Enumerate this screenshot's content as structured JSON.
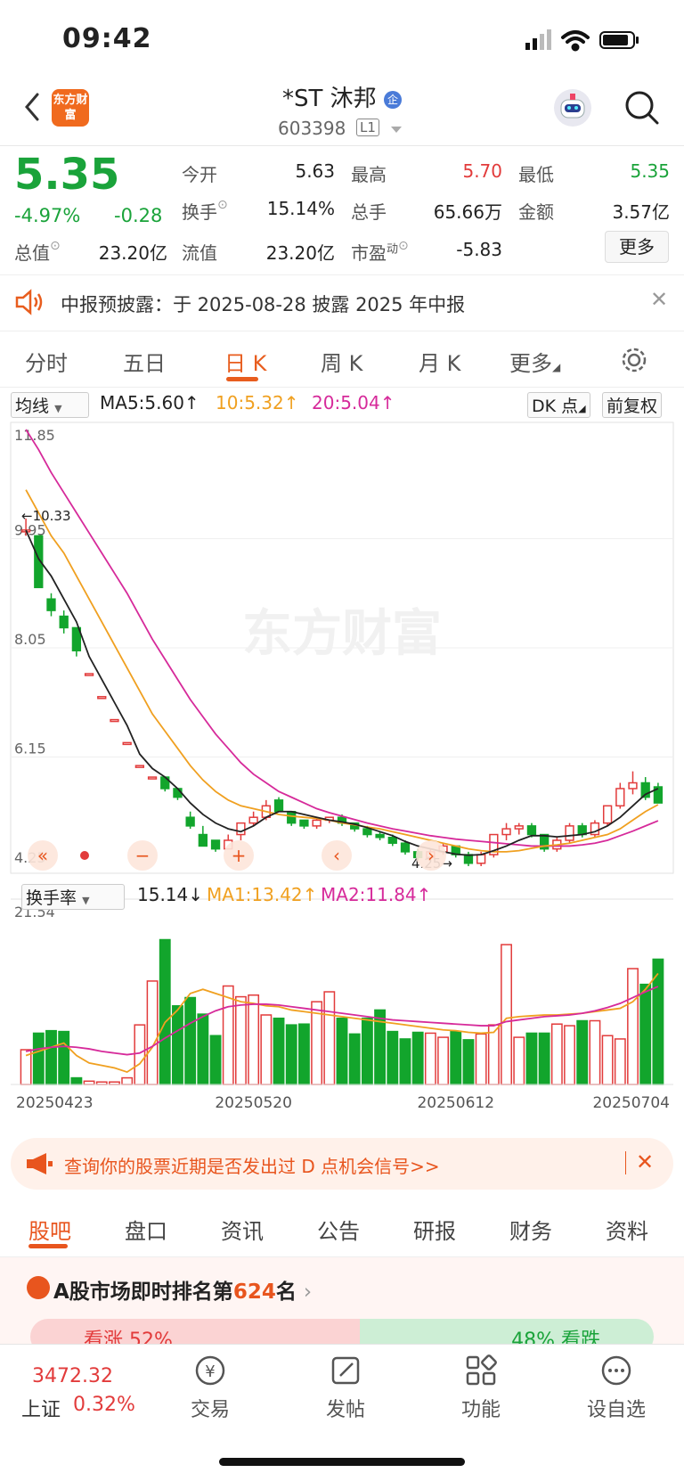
{
  "status": {
    "time": "09:42"
  },
  "header": {
    "logo_text": "东方财富",
    "stock_name": "*ST 沐邦",
    "code": "603398",
    "level_badge": "L1"
  },
  "quote": {
    "price": "5.35",
    "pct_change": "-4.97%",
    "change": "-0.28",
    "open_label": "今开",
    "open_val": "5.63",
    "high_label": "最高",
    "high_val": "5.70",
    "low_label": "最低",
    "low_val": "5.35",
    "turnover_label": "换手",
    "turnover_val": "15.14%",
    "vol_label": "总手",
    "vol_val": "65.66万",
    "amount_label": "金额",
    "amount_val": "3.57亿",
    "mktcap_label": "总值",
    "mktcap_val": "23.20亿",
    "float_label": "流值",
    "float_val": "23.20亿",
    "pe_label": "市盈",
    "pe_sup": "动",
    "pe_val": "-5.83",
    "more_label": "更多"
  },
  "notice": {
    "text": "中报预披露：于 2025-08-28 披露 2025 年中报"
  },
  "tabs": [
    "分时",
    "五日",
    "日 K",
    "周 K",
    "月 K",
    "更多"
  ],
  "chart_toolbar": {
    "ma_select": "均线",
    "ma5": "MA5:5.60↑",
    "ma10": "10:5.32↑",
    "ma20": "20:5.04↑",
    "dk_btn": "DK 点",
    "adjust_btn": "前复权",
    "vol_select": "换手率",
    "vol_val": "15.14↓",
    "vol_ma1": "MA1:13.42↑",
    "vol_ma2": "MA2:11.84↑"
  },
  "colors": {
    "up": "#e23b3b",
    "down": "#12a52c",
    "ma5": "#222222",
    "ma10": "#f0a020",
    "ma20": "#d62a9a",
    "accent": "#e8551e"
  },
  "chart_data": {
    "type": "candlestick",
    "price_axis": {
      "ticks": [
        "11.85",
        "9.95",
        "8.05",
        "6.15",
        "4.25"
      ],
      "ylim": [
        4.25,
        11.85
      ]
    },
    "annotations": {
      "high_label": "10.33",
      "low_label": "4.25"
    },
    "watermark": "东方财富",
    "dates": [
      "20250423",
      "20250520",
      "20250612",
      "20250704"
    ],
    "candles": [
      [
        10.1,
        10.1,
        10.3,
        10.0
      ],
      [
        10.0,
        9.1,
        10.0,
        9.1
      ],
      [
        8.9,
        8.7,
        9.0,
        8.6
      ],
      [
        8.6,
        8.4,
        8.7,
        8.3
      ],
      [
        8.4,
        8.0,
        8.4,
        7.9
      ],
      [
        7.6,
        7.6,
        7.6,
        7.6
      ],
      [
        7.2,
        7.2,
        7.2,
        7.2
      ],
      [
        6.8,
        6.8,
        6.8,
        6.8
      ],
      [
        6.4,
        6.4,
        6.4,
        6.4
      ],
      [
        6.0,
        6.0,
        6.0,
        6.0
      ],
      [
        5.8,
        5.8,
        5.8,
        5.8
      ],
      [
        5.8,
        5.6,
        5.8,
        5.55
      ],
      [
        5.6,
        5.45,
        5.6,
        5.4
      ],
      [
        5.1,
        4.95,
        5.2,
        4.9
      ],
      [
        4.8,
        4.6,
        4.95,
        4.6
      ],
      [
        4.7,
        4.55,
        4.7,
        4.5
      ],
      [
        4.55,
        4.7,
        4.8,
        4.55
      ],
      [
        4.8,
        5.0,
        5.0,
        4.7
      ],
      [
        5.0,
        5.1,
        5.2,
        4.95
      ],
      [
        5.1,
        5.3,
        5.4,
        5.05
      ],
      [
        5.4,
        5.2,
        5.45,
        5.2
      ],
      [
        5.2,
        5.0,
        5.2,
        4.95
      ],
      [
        5.05,
        4.95,
        5.05,
        4.9
      ],
      [
        4.95,
        5.05,
        5.1,
        4.9
      ],
      [
        5.05,
        5.1,
        5.1,
        5.0
      ],
      [
        5.1,
        5.0,
        5.15,
        4.95
      ],
      [
        5.0,
        4.9,
        5.0,
        4.85
      ],
      [
        4.9,
        4.8,
        4.95,
        4.75
      ],
      [
        4.8,
        4.75,
        4.85,
        4.7
      ],
      [
        4.75,
        4.65,
        4.8,
        4.6
      ],
      [
        4.65,
        4.5,
        4.7,
        4.45
      ],
      [
        4.5,
        4.4,
        4.55,
        4.35
      ],
      [
        4.4,
        4.5,
        4.55,
        4.35
      ],
      [
        4.5,
        4.6,
        4.65,
        4.45
      ],
      [
        4.6,
        4.45,
        4.6,
        4.4
      ],
      [
        4.45,
        4.3,
        4.5,
        4.25
      ],
      [
        4.3,
        4.45,
        4.5,
        4.25
      ],
      [
        4.45,
        4.8,
        4.8,
        4.4
      ],
      [
        4.8,
        4.9,
        5.0,
        4.7
      ],
      [
        4.9,
        4.95,
        5.0,
        4.8
      ],
      [
        4.95,
        4.8,
        5.0,
        4.75
      ],
      [
        4.8,
        4.55,
        4.8,
        4.5
      ],
      [
        4.55,
        4.7,
        4.75,
        4.5
      ],
      [
        4.7,
        4.95,
        5.0,
        4.65
      ],
      [
        4.95,
        4.8,
        5.0,
        4.75
      ],
      [
        4.8,
        5.0,
        5.05,
        4.75
      ],
      [
        5.0,
        5.3,
        5.3,
        4.95
      ],
      [
        5.3,
        5.6,
        5.7,
        5.25
      ],
      [
        5.6,
        5.7,
        5.9,
        5.5
      ],
      [
        5.7,
        5.45,
        5.8,
        5.4
      ],
      [
        5.63,
        5.35,
        5.7,
        5.35
      ]
    ],
    "ma5": [
      10.1,
      9.6,
      9.3,
      8.9,
      8.5,
      7.9,
      7.5,
      7.1,
      6.7,
      6.2,
      5.95,
      5.8,
      5.6,
      5.35,
      5.15,
      5.0,
      4.9,
      4.85,
      4.95,
      5.1,
      5.2,
      5.2,
      5.15,
      5.1,
      5.05,
      5.02,
      4.98,
      4.92,
      4.85,
      4.78,
      4.68,
      4.6,
      4.55,
      4.5,
      4.46,
      4.44,
      4.45,
      4.52,
      4.6,
      4.7,
      4.78,
      4.78,
      4.76,
      4.78,
      4.8,
      4.85,
      4.95,
      5.1,
      5.3,
      5.5,
      5.6
    ],
    "ma10": [
      10.8,
      10.4,
      10.0,
      9.7,
      9.3,
      8.9,
      8.5,
      8.1,
      7.7,
      7.3,
      6.9,
      6.6,
      6.3,
      6.0,
      5.75,
      5.55,
      5.4,
      5.3,
      5.25,
      5.2,
      5.15,
      5.12,
      5.1,
      5.08,
      5.05,
      5.0,
      4.97,
      4.93,
      4.9,
      4.85,
      4.8,
      4.75,
      4.7,
      4.65,
      4.6,
      4.55,
      4.52,
      4.5,
      4.5,
      4.52,
      4.56,
      4.6,
      4.62,
      4.65,
      4.7,
      4.75,
      4.8,
      4.9,
      5.05,
      5.2,
      5.32
    ],
    "ma20": [
      11.85,
      11.5,
      11.1,
      10.75,
      10.4,
      10.05,
      9.7,
      9.35,
      9.0,
      8.6,
      8.2,
      7.85,
      7.5,
      7.15,
      6.85,
      6.55,
      6.3,
      6.05,
      5.85,
      5.7,
      5.55,
      5.45,
      5.35,
      5.25,
      5.18,
      5.12,
      5.06,
      5.0,
      4.95,
      4.9,
      4.86,
      4.82,
      4.78,
      4.75,
      4.72,
      4.7,
      4.68,
      4.66,
      4.64,
      4.62,
      4.6,
      4.6,
      4.6,
      4.6,
      4.62,
      4.65,
      4.7,
      4.78,
      4.86,
      4.95,
      5.04
    ],
    "volume_axis": {
      "top_tick": "21.54"
    },
    "volume": [
      4.2,
      6.2,
      6.5,
      6.4,
      0.8,
      0.4,
      0.3,
      0.3,
      0.8,
      7.2,
      12.5,
      17.5,
      9.5,
      10.5,
      8.5,
      5.9,
      11.9,
      10.6,
      10.8,
      8.4,
      8.0,
      7.2,
      7.3,
      10.0,
      11.2,
      8.0,
      6.1,
      8.0,
      9.0,
      6.4,
      5.5,
      6.3,
      6.2,
      5.7,
      6.4,
      5.4,
      6.1,
      7.2,
      16.9,
      5.7,
      6.2,
      6.2,
      7.3,
      7.1,
      7.7,
      7.7,
      5.9,
      5.5,
      14.0,
      12.1,
      15.14
    ],
    "vol_ma1": [
      3.5,
      4.0,
      4.5,
      5.0,
      3.5,
      2.6,
      2.3,
      2.0,
      1.5,
      2.5,
      4.5,
      7.5,
      9.0,
      11.0,
      11.5,
      11.0,
      10.5,
      10.0,
      9.8,
      9.5,
      9.4,
      9.0,
      8.8,
      8.6,
      8.4,
      8.2,
      8.0,
      7.8,
      7.6,
      7.4,
      7.2,
      7.0,
      6.8,
      6.6,
      6.5,
      6.3,
      6.2,
      6.3,
      8.0,
      8.2,
      8.3,
      8.4,
      8.4,
      8.5,
      8.6,
      8.8,
      9.0,
      9.2,
      10.0,
      11.5,
      13.42
    ],
    "vol_ma2": [
      4.0,
      4.3,
      4.5,
      4.6,
      4.5,
      4.3,
      4.0,
      3.8,
      3.6,
      3.8,
      4.6,
      5.6,
      6.5,
      7.4,
      8.2,
      8.9,
      9.4,
      9.6,
      9.7,
      9.7,
      9.6,
      9.4,
      9.2,
      9.0,
      8.8,
      8.6,
      8.4,
      8.2,
      8.0,
      7.8,
      7.7,
      7.6,
      7.5,
      7.4,
      7.3,
      7.2,
      7.1,
      7.1,
      7.6,
      7.8,
      8.0,
      8.2,
      8.3,
      8.4,
      8.6,
      8.9,
      9.3,
      9.8,
      10.5,
      11.2,
      11.84
    ]
  },
  "banner": {
    "text": "查询你的股票近期是否发出过 D 点机会信号>>"
  },
  "bottom_tabs": [
    "股吧",
    "盘口",
    "资讯",
    "公告",
    "研报",
    "财务",
    "资料"
  ],
  "rank": {
    "prefix": "A股市场即时排名第",
    "num": "624",
    "suffix": "名",
    "up_label": "看涨 52%",
    "down_label": "48% 看跌"
  },
  "footer": {
    "index_val": "3472.32",
    "index_name": "上证",
    "index_pct": "0.32%",
    "nav": [
      "交易",
      "发帖",
      "功能",
      "设自选"
    ]
  }
}
